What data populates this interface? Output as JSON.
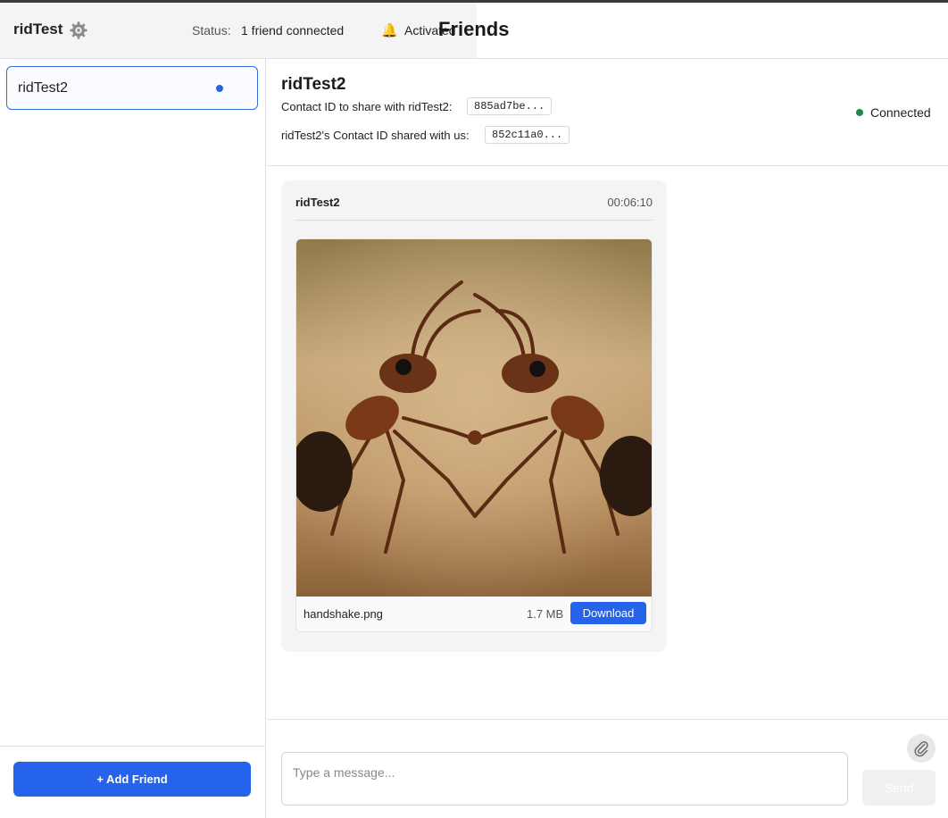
{
  "header": {
    "app_name": "ridTest",
    "status_label": "Status:",
    "status_value": "1 friend connected",
    "notifications_value": "Activated",
    "friends_title": "Friends"
  },
  "sidebar": {
    "friends": [
      {
        "name": "ridTest2",
        "online": true
      }
    ],
    "add_friend_label": "+ Add Friend"
  },
  "chat": {
    "friend_name": "ridTest2",
    "contact_id_label": "Contact ID to share with ridTest2:",
    "contact_id_value": "885ad7be...",
    "their_id_label": "ridTest2's Contact ID shared with us:",
    "their_id_value": "852c11a0...",
    "connection_status": "Connected",
    "messages": [
      {
        "sender": "ridTest2",
        "time": "00:06:10",
        "attachment": {
          "file_name": "handshake.png",
          "file_size": "1.7 MB",
          "download_label": "Download"
        }
      }
    ]
  },
  "composer": {
    "placeholder": "Type a message...",
    "value": "",
    "send_label": "Send"
  },
  "colors": {
    "accent": "#2563eb",
    "connected": "#1f8a4c"
  }
}
